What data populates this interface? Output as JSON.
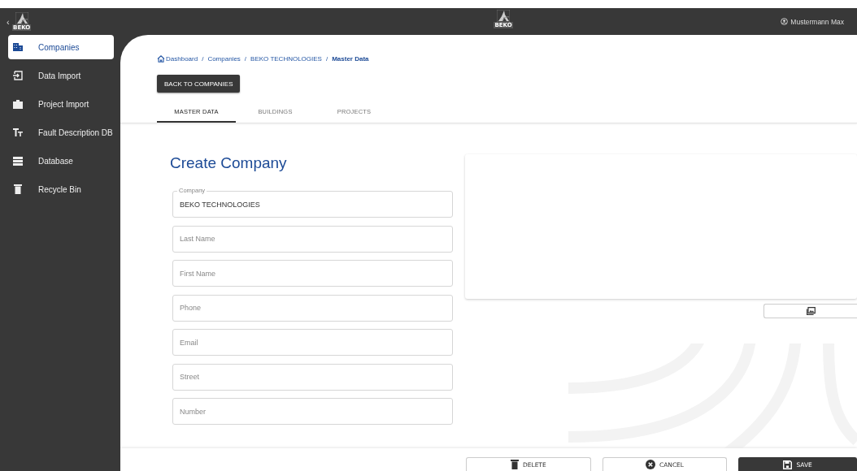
{
  "sidebar": {
    "collapse": "‹",
    "logo_text": "BEKO",
    "items": [
      {
        "label": "Companies",
        "selected": true
      },
      {
        "label": "Data Import",
        "selected": false
      },
      {
        "label": "Project Import",
        "selected": false
      },
      {
        "label": "Fault Description DB",
        "selected": false
      },
      {
        "label": "Database",
        "selected": false
      },
      {
        "label": "Recycle Bin",
        "selected": false
      }
    ]
  },
  "top_bar": {
    "logo_text": "BEKO",
    "user": "Mustermann Max"
  },
  "breadcrumb": [
    {
      "label": "Dashboard",
      "current": false
    },
    {
      "label": "Companies",
      "current": false
    },
    {
      "label": "BEKO TECHNOLOGIES",
      "current": false
    },
    {
      "label": "Master Data",
      "current": true
    }
  ],
  "breadcrumb_separator": "/",
  "back_button": "BACK TO COMPANIES",
  "tabs": [
    {
      "label": "MASTER DATA",
      "selected": true
    },
    {
      "label": "BUILDINGS",
      "selected": false
    },
    {
      "label": "PROJECTS",
      "selected": false
    }
  ],
  "form": {
    "title": "Create Company",
    "fields": [
      {
        "label": "Company",
        "value": "BEKO TECHNOLOGIES"
      },
      {
        "placeholder": "Last Name"
      },
      {
        "placeholder": "First Name"
      },
      {
        "placeholder": "Phone"
      },
      {
        "placeholder": "Email"
      },
      {
        "placeholder": "Street"
      },
      {
        "placeholder": "Number"
      }
    ]
  },
  "footer_buttons": [
    {
      "label": "DELETE",
      "kind": "outline"
    },
    {
      "label": "CANCEL",
      "kind": "outline"
    },
    {
      "label": "SAVE",
      "kind": "primary"
    }
  ]
}
